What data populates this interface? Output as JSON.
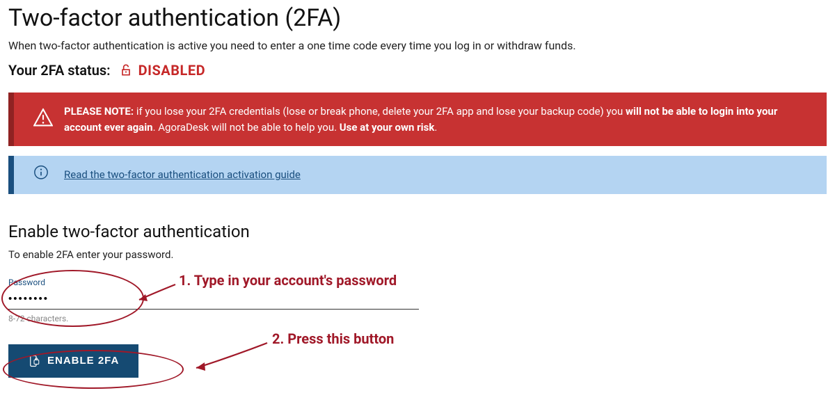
{
  "title": "Two-factor authentication (2FA)",
  "description": "When two-factor authentication is active you need to enter a one time code every time you log in or withdraw funds.",
  "status": {
    "label": "Your 2FA status:",
    "value": "DISABLED"
  },
  "warning": {
    "prefix": "PLEASE NOTE:",
    "text1": " if you lose your 2FA credentials (lose or break phone, delete your 2FA app and lose your backup code) you ",
    "bold1": "will not be able to login into your account ever again",
    "text2": ". AgoraDesk will not be able to help you. ",
    "bold2": "Use at your own risk",
    "text3": "."
  },
  "info": {
    "link": "Read the two-factor authentication activation guide"
  },
  "enable_section": {
    "heading": "Enable two-factor authentication",
    "instructions": "To enable 2FA enter your password.",
    "field_label": "Password",
    "field_value": "••••••••",
    "field_helper": "8-72 characters.",
    "button": "ENABLE 2FA"
  },
  "annotations": {
    "step1": "1. Type in your account's password",
    "step2": "2. Press this button"
  }
}
